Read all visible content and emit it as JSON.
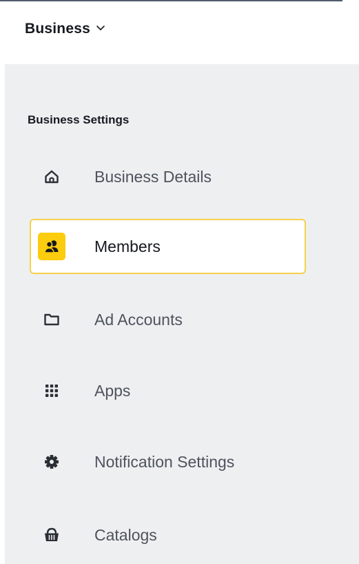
{
  "header": {
    "business_name": "Business"
  },
  "sidebar": {
    "section_title": "Business Settings",
    "items": [
      {
        "label": "Business Details",
        "icon": "home-icon",
        "active": false
      },
      {
        "label": "Members",
        "icon": "members-icon",
        "active": true
      },
      {
        "label": "Ad Accounts",
        "icon": "folder-icon",
        "active": false
      },
      {
        "label": "Apps",
        "icon": "grid-dots-icon",
        "active": false
      },
      {
        "label": "Notification Settings",
        "icon": "gear-icon",
        "active": false
      },
      {
        "label": "Catalogs",
        "icon": "basket-icon",
        "active": false
      }
    ]
  },
  "colors": {
    "accent_yellow": "#fccc0e",
    "active_border": "#f5d14b",
    "sidebar_bg": "#eeeff1",
    "text_dark": "#16191f",
    "text_muted": "#4d535d"
  }
}
